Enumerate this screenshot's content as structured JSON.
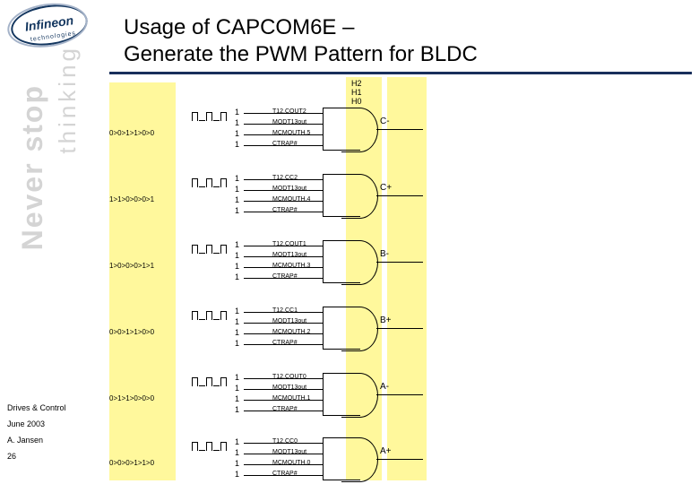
{
  "logo": {
    "name": "Infineon",
    "sub": "technologies"
  },
  "title_line1": "Usage of CAPCOM6E –",
  "title_line2": "Generate the PWM Pattern for BLDC",
  "sidebar": {
    "large": "Never stop",
    "small": "thinking"
  },
  "meta": {
    "dept": "Drives & Control",
    "date": "June 2003",
    "author": "A. Jansen",
    "page": "26"
  },
  "top_labels": [
    "H2",
    "H1",
    "H0"
  ],
  "groups": [
    {
      "seq": "0>0>1>1>0>0",
      "in": [
        "T12.COUT2",
        "MODT13out",
        "MCMOUTH.5",
        "CTRAP#"
      ],
      "out": "C-"
    },
    {
      "seq": "1>1>0>0>0>1",
      "in": [
        "T12.CC2",
        "MODT13out",
        "MCMOUTH.4",
        "CTRAP#"
      ],
      "out": "C+"
    },
    {
      "seq": "1>0>0>0>1>1",
      "in": [
        "T12.COUT1",
        "MODT13out",
        "MCMOUTH.3",
        "CTRAP#"
      ],
      "out": "B-"
    },
    {
      "seq": "0>0>1>1>0>0",
      "in": [
        "T12.CC1",
        "MODT13out",
        "MCMOUTH.2",
        "CTRAP#"
      ],
      "out": "B+"
    },
    {
      "seq": "0>1>1>0>0>0",
      "in": [
        "T12.COUT0",
        "MODT13out",
        "MCMOUTH.1",
        "CTRAP#"
      ],
      "out": "A-"
    },
    {
      "seq": "0>0>0>1>1>0",
      "in": [
        "T12.CC0",
        "MODT13out",
        "MCMOUTH.0",
        "CTRAP#"
      ],
      "out": "A+"
    }
  ]
}
